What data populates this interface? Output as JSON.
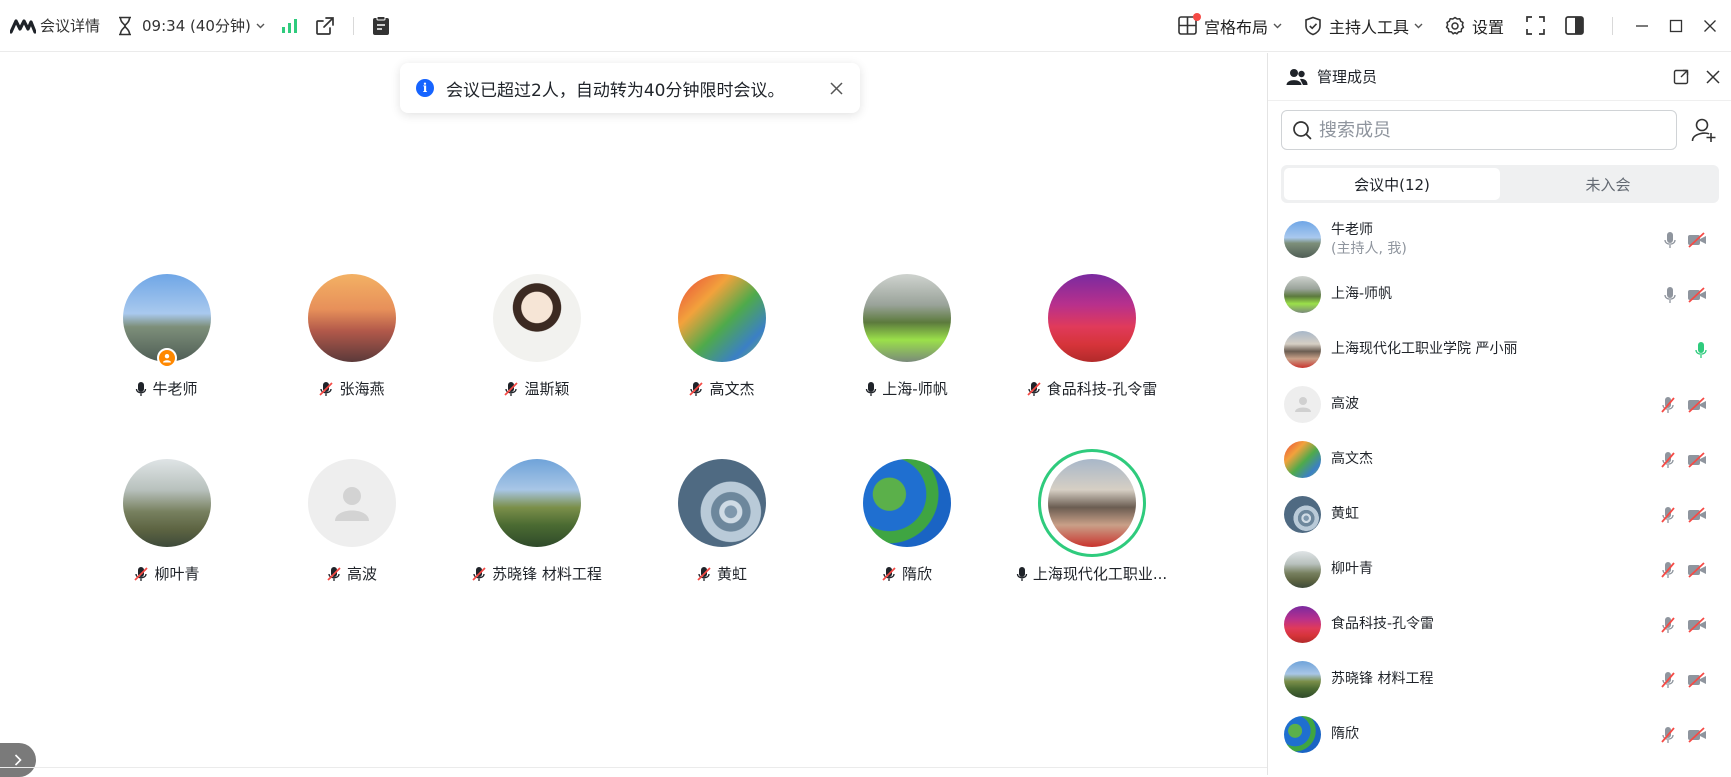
{
  "toolbar": {
    "meeting_details": "会议详情",
    "timer": "09:34 (40分钟)",
    "layout": "宫格布局",
    "host_tools": "主持人工具",
    "settings": "设置"
  },
  "toast": {
    "message": "会议已超过2人，自动转为40分钟限时会议。"
  },
  "grid": [
    {
      "name": "牛老师",
      "mic": "on",
      "host": true
    },
    {
      "name": "张海燕",
      "mic": "off"
    },
    {
      "name": "温斯颖",
      "mic": "off"
    },
    {
      "name": "高文杰",
      "mic": "off"
    },
    {
      "name": "上海-师帆",
      "mic": "on"
    },
    {
      "name": "食品科技-孔令雷",
      "mic": "off"
    },
    {
      "name": "柳叶青",
      "mic": "off"
    },
    {
      "name": "高波",
      "mic": "off"
    },
    {
      "name": "苏晓锋 材料工程",
      "mic": "off"
    },
    {
      "name": "黄虹",
      "mic": "off"
    },
    {
      "name": "隋欣",
      "mic": "off"
    },
    {
      "name": "上海现代化工职业...",
      "mic": "on",
      "speaking": true
    }
  ],
  "panel": {
    "title": "管理成员",
    "search_placeholder": "搜索成员",
    "tab_in_meeting": "会议中(12)",
    "tab_not_joined": "未入会",
    "members": [
      {
        "name": "牛老师",
        "sub": "(主持人, 我)",
        "mic": "on"
      },
      {
        "name": "上海-师帆",
        "mic": "on"
      },
      {
        "name": "上海现代化工职业学院 严小丽",
        "mic": "speaking"
      },
      {
        "name": "高波",
        "mic": "off"
      },
      {
        "name": "高文杰",
        "mic": "off"
      },
      {
        "name": "黄虹",
        "mic": "off"
      },
      {
        "name": "柳叶青",
        "mic": "off"
      },
      {
        "name": "食品科技-孔令雷",
        "mic": "off"
      },
      {
        "name": "苏晓锋 材料工程",
        "mic": "off"
      },
      {
        "name": "隋欣",
        "mic": "off"
      }
    ]
  },
  "colors": {
    "accent_green": "#2fcb7d",
    "info_blue": "#1664ff",
    "host_orange": "#ff8800",
    "mute_red": "#f54a45"
  }
}
